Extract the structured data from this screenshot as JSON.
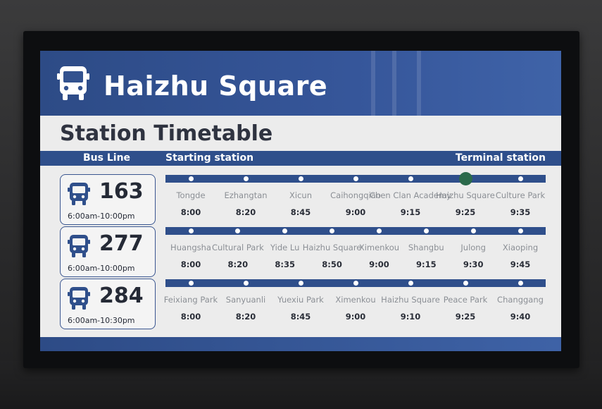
{
  "header": {
    "station_name": "Haizhu Square",
    "bus_icon": "bus-icon"
  },
  "subtitle": "Station Timetable",
  "columns": {
    "bus_line": "Bus Line",
    "starting": "Starting station",
    "terminal": "Terminal station"
  },
  "colors": {
    "primary": "#2f4f8b",
    "current_stop": "#2b6a4b",
    "text_dark": "#2a2e38",
    "text_muted": "#8b8f95"
  },
  "routes": [
    {
      "number": "163",
      "hours": "6:00am-10:00pm",
      "current_stop_index": 5,
      "stops": [
        {
          "name": "Tongde",
          "time": "8:00"
        },
        {
          "name": "Ezhangtan",
          "time": "8:20"
        },
        {
          "name": "Xicun",
          "time": "8:45"
        },
        {
          "name": "Caihongqiao",
          "time": "9:00"
        },
        {
          "name": "Chen Clan Academy",
          "time": "9:15"
        },
        {
          "name": "Haizhu Square",
          "time": "9:25"
        },
        {
          "name": "Culture Park",
          "time": "9:35"
        }
      ]
    },
    {
      "number": "277",
      "hours": "6:00am-10:00pm",
      "current_stop_index": -1,
      "stops": [
        {
          "name": "Huangsha",
          "time": "8:00"
        },
        {
          "name": "Cultural Park",
          "time": "8:20"
        },
        {
          "name": "Yide Lu",
          "time": "8:35"
        },
        {
          "name": "Haizhu Square",
          "time": "8:50"
        },
        {
          "name": "Ximenkou",
          "time": "9:00"
        },
        {
          "name": "Shangbu",
          "time": "9:15"
        },
        {
          "name": "Julong",
          "time": "9:30"
        },
        {
          "name": "Xiaoping",
          "time": "9:45"
        }
      ]
    },
    {
      "number": "284",
      "hours": "6:00am-10:30pm",
      "current_stop_index": -1,
      "stops": [
        {
          "name": "Feixiang Park",
          "time": "8:00"
        },
        {
          "name": "Sanyuanli",
          "time": "8:20"
        },
        {
          "name": "Yuexiu Park",
          "time": "8:45"
        },
        {
          "name": "Ximenkou",
          "time": "9:00"
        },
        {
          "name": "Haizhu Square",
          "time": "9:10"
        },
        {
          "name": "Peace Park",
          "time": "9:25"
        },
        {
          "name": "Changgang",
          "time": "9:40"
        }
      ]
    }
  ]
}
